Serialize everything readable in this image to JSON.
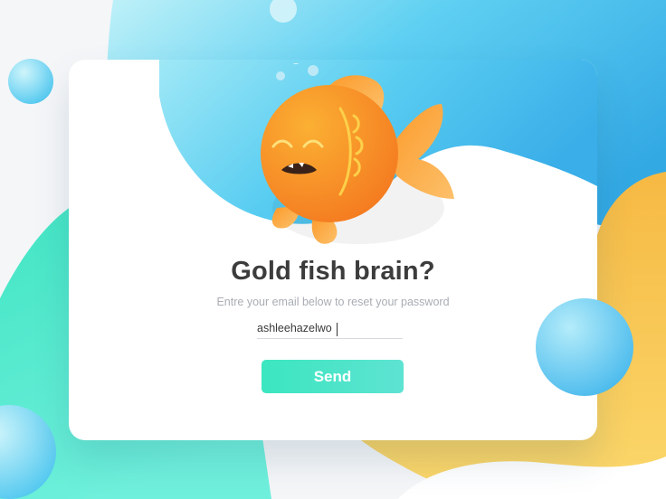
{
  "colors": {
    "accent_blue": "#3aaee8",
    "accent_green": "#3be6c0",
    "accent_yellow": "#f7c95a",
    "fish_orange": "#fb8a22",
    "title_text": "#3c3c3c"
  },
  "illustration": {
    "icon": "goldfish-icon"
  },
  "form": {
    "title": "Gold fish brain?",
    "subtitle": "Entre your email below to reset your password",
    "email_value": "ashleehazelwo",
    "send_label": "Send"
  }
}
